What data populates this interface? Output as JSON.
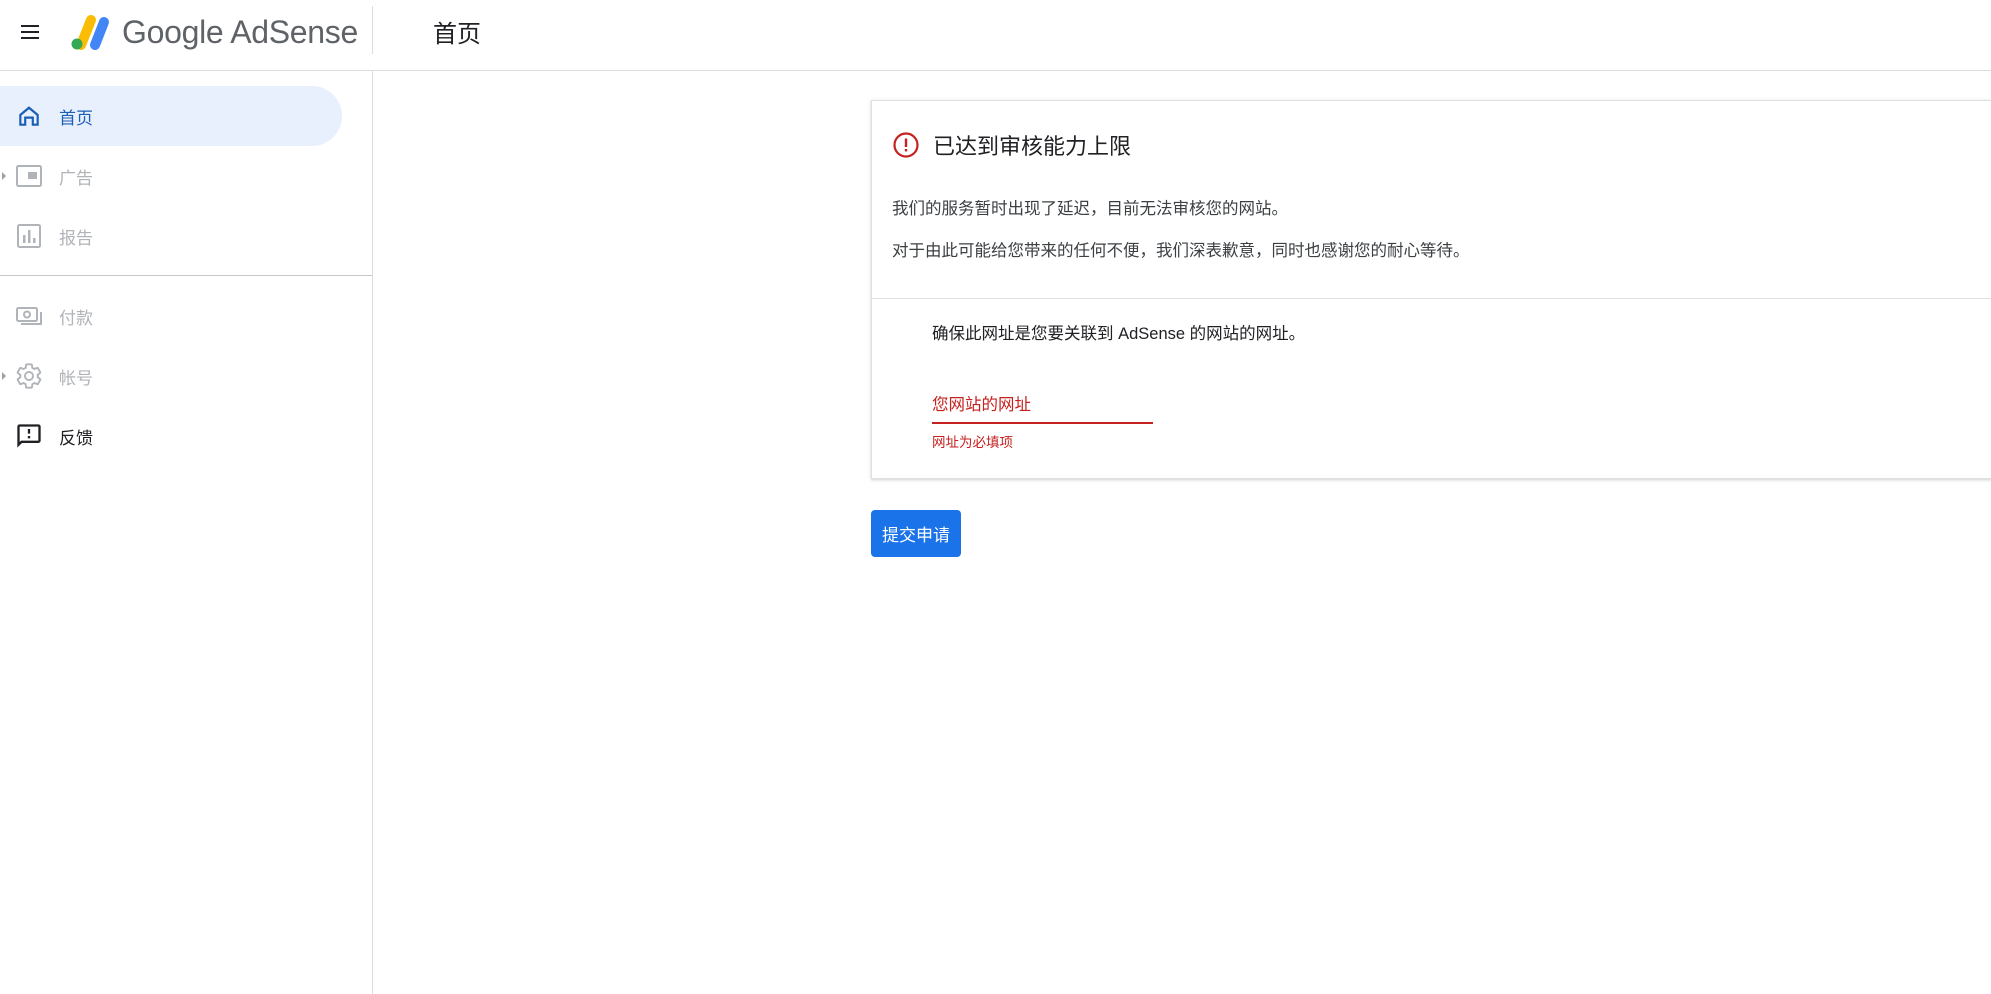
{
  "header": {
    "brand_name": "Google AdSense",
    "page_title": "首页"
  },
  "sidebar": {
    "items": [
      {
        "label": "首页",
        "icon": "home-icon",
        "state": "active"
      },
      {
        "label": "广告",
        "icon": "ads-icon",
        "state": "disabled",
        "expandable": true
      },
      {
        "label": "报告",
        "icon": "reports-icon",
        "state": "disabled"
      },
      {
        "label": "付款",
        "icon": "payments-icon",
        "state": "disabled"
      },
      {
        "label": "帐号",
        "icon": "settings-icon",
        "state": "disabled",
        "expandable": true
      },
      {
        "label": "反馈",
        "icon": "feedback-icon",
        "state": "normal"
      }
    ]
  },
  "alert_card": {
    "title": "已达到审核能力上限",
    "paragraph_1": "我们的服务暂时出现了延迟，目前无法审核您的网站。",
    "paragraph_2": "对于由此可能给您带来的任何不便，我们深表歉意，同时也感谢您的耐心等待。",
    "url_prompt": "确保此网址是您要关联到 AdSense 的网站的网址。",
    "url_field": {
      "value": "",
      "placeholder": "您网站的网址"
    },
    "url_error": "网址为必填项"
  },
  "actions": {
    "submit_label": "提交申请"
  },
  "colors": {
    "accent": "#1a73e8",
    "active_nav_bg": "#e8f0fe",
    "error": "#c5221f"
  }
}
